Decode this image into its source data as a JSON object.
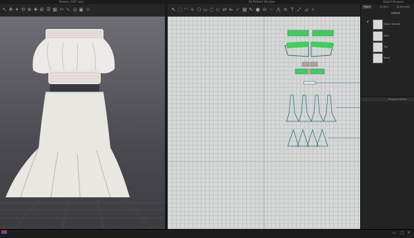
{
  "titlebar": {
    "file_title": "Korean_1457.zprj",
    "pattern_title": "2D Pattern Window",
    "browser_title": "Object Browser"
  },
  "panel": {
    "tabs": [
      "Fabric",
      "Button",
      "Buttonhole"
    ],
    "default_label": "Default",
    "items": [
      "Fabric Default",
      "Skirt",
      "Top",
      "Band"
    ],
    "property_title": "Property Editor"
  },
  "colors": {
    "accent": "#e8c23a",
    "green_piece": "#3ecf58",
    "outline": "#2e6f7a",
    "garment": "#ecebe6",
    "grid_bg": "#d6d9d8"
  }
}
